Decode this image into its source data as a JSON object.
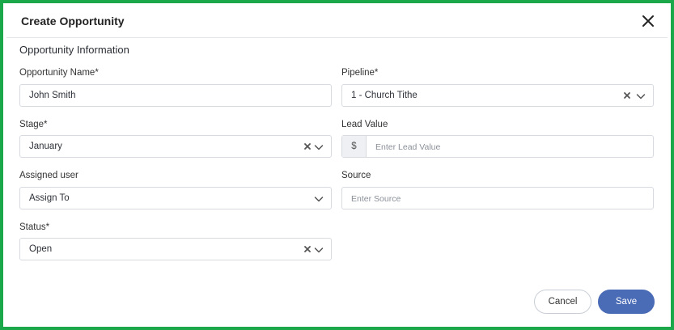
{
  "dialog": {
    "title": "Create Opportunity",
    "section_title": "Opportunity Information"
  },
  "fields": {
    "opportunity_name": {
      "label": "Opportunity Name*",
      "value": "John Smith"
    },
    "pipeline": {
      "label": "Pipeline*",
      "value": "1 - Church Tithe"
    },
    "stage": {
      "label": "Stage*",
      "value": "January"
    },
    "lead_value": {
      "label": "Lead Value",
      "prefix": "$",
      "placeholder": "Enter Lead Value"
    },
    "assigned_user": {
      "label": "Assigned user",
      "value": "Assign To"
    },
    "source": {
      "label": "Source",
      "placeholder": "Enter Source"
    },
    "status": {
      "label": "Status*",
      "value": "Open"
    }
  },
  "actions": {
    "cancel_label": "Cancel",
    "save_label": "Save"
  },
  "icons": {
    "close": "close-icon",
    "clear": "clear-x-icon",
    "dropdown": "chevron-down-icon"
  },
  "colors": {
    "frame_border": "#1aa84a",
    "primary_button": "#4a6bb5"
  }
}
